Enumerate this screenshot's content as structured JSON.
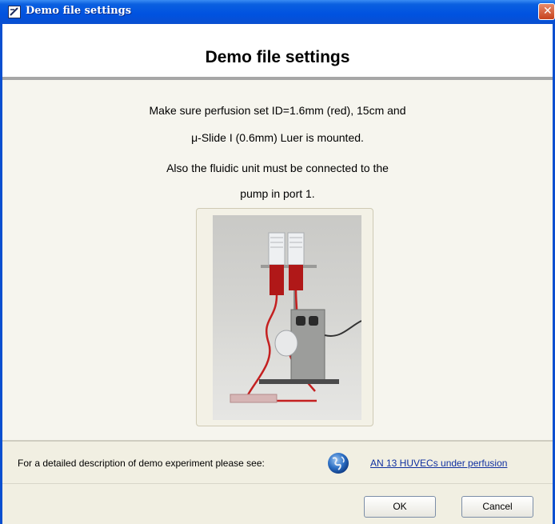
{
  "window": {
    "title": "Demo file settings"
  },
  "header": {
    "title": "Demo file settings"
  },
  "instructions": {
    "line1": "Make sure perfusion set ID=1.6mm (red), 15cm and",
    "line2": "μ-Slide I (0.6mm) Luer is mounted.",
    "line3": "Also the fluidic unit must be connected to the",
    "line4": "pump in port 1."
  },
  "footer": {
    "description": "For a detailed description of demo experiment please see:",
    "link_text": "AN 13 HUVECs under perfusion",
    "link_icon": "globe-icon"
  },
  "buttons": {
    "ok_label": "OK",
    "cancel_label": "Cancel"
  },
  "colors": {
    "titlebar": "#0052e0",
    "close": "#c7431e",
    "link": "#1030a0",
    "fluid": "#b01818"
  }
}
